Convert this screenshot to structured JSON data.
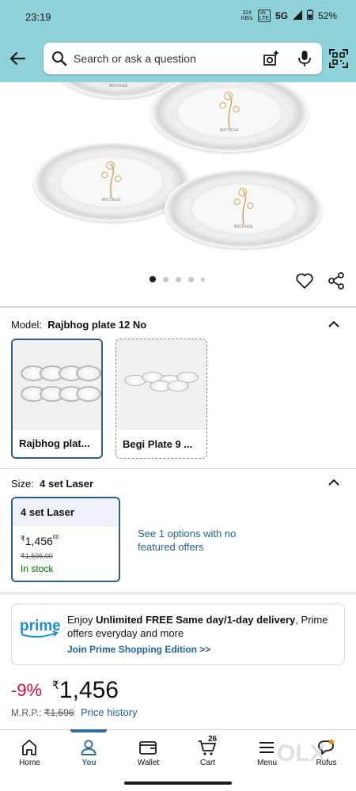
{
  "status_bar": {
    "time": "23:19",
    "speed": "324\nKB/s",
    "network": "5G",
    "battery": "52%"
  },
  "search": {
    "placeholder": "Search or ask a question"
  },
  "gallery": {
    "plate_brand": "MOTAGE",
    "image_count": 5,
    "active_index": 0
  },
  "model": {
    "label": "Model:",
    "value": "Rajbhog plate 12 No",
    "options": [
      {
        "label": "Rajbhog plat..."
      },
      {
        "label": "Begi Plate 9 ..."
      }
    ]
  },
  "size": {
    "label": "Size:",
    "value": "4 set Laser",
    "option": {
      "title": "4 set Laser",
      "currency": "₹",
      "price_main": "1,456",
      "price_fraction": "00",
      "mrp": "₹1,596.00",
      "stock": "In stock"
    },
    "see_options": "See 1 options with no featured offers"
  },
  "prime": {
    "logo_text": "prime",
    "text_pre": "Enjoy ",
    "text_bold": "Unlimited FREE Same day/1-day delivery",
    "text_post": ", Prime offers everyday and more",
    "join_label": "Join Prime Shopping Edition >>"
  },
  "pricing": {
    "discount": "-9%",
    "currency": "₹",
    "price": "1,456",
    "mrp_label": "M.R.P.:",
    "mrp_value": "₹1,596",
    "price_history": "Price history"
  },
  "bottom_nav": {
    "items": [
      {
        "label": "Home",
        "icon": "home-icon"
      },
      {
        "label": "You",
        "icon": "person-icon",
        "active": true
      },
      {
        "label": "Wallet",
        "icon": "wallet-icon"
      },
      {
        "label": "Cart",
        "icon": "cart-icon",
        "count": "26"
      },
      {
        "label": "Menu",
        "icon": "menu-icon"
      },
      {
        "label": "Rufus",
        "icon": "rufus-icon"
      }
    ]
  },
  "watermark": {
    "text": "OLX"
  },
  "colors": {
    "header_bg": "#8fd1d9",
    "link": "#2162a1",
    "discount": "#cc0c39",
    "selected_border": "#2d5f8b",
    "in_stock": "#007600"
  }
}
